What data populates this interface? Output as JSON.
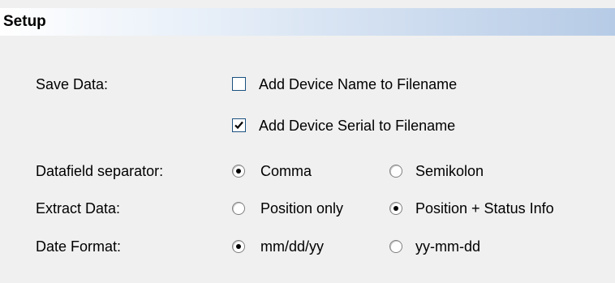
{
  "panel": {
    "title": "Setup"
  },
  "rows": {
    "save_data": {
      "label": "Save Data:",
      "options": [
        {
          "text": "Add Device Name to Filename",
          "checked": false
        },
        {
          "text": "Add Device Serial to Filename",
          "checked": true
        }
      ]
    },
    "separator": {
      "label": "Datafield separator:",
      "options": [
        {
          "text": "Comma",
          "selected": true
        },
        {
          "text": "Semikolon",
          "selected": false
        }
      ]
    },
    "extract": {
      "label": "Extract Data:",
      "options": [
        {
          "text": "Position only",
          "selected": false
        },
        {
          "text": "Position + Status Info",
          "selected": true
        }
      ]
    },
    "date_format": {
      "label": "Date Format:",
      "options": [
        {
          "text": "mm/dd/yy",
          "selected": true
        },
        {
          "text": "yy-mm-dd",
          "selected": false
        }
      ]
    }
  },
  "colors": {
    "background": "#f0f0f0",
    "header_gradient_end": "#b6cbe6",
    "checkbox_border": "#1c5180"
  }
}
